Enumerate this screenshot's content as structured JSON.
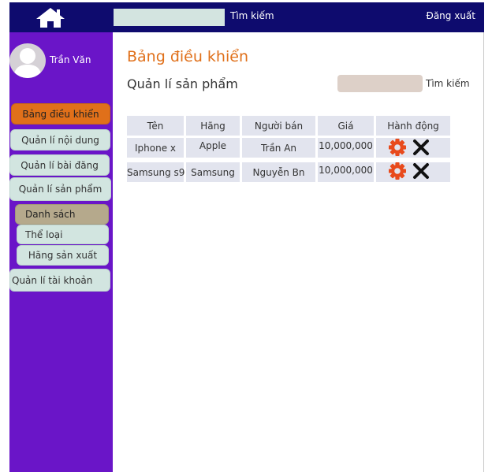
{
  "header": {
    "search_label": "Tìm kiếm",
    "search_value": "",
    "logout_label": "Đăng xuất"
  },
  "sidebar": {
    "username": "Trần Văn",
    "items": [
      {
        "label": "Bảng điều khiển"
      },
      {
        "label": "Quản lí nội dung"
      },
      {
        "label": "Quản lí bài đăng"
      },
      {
        "label": "Quản lí sản phẩm"
      },
      {
        "label": "Danh sách"
      },
      {
        "label": "Thể loại"
      },
      {
        "label": "Hãng sản xuất"
      },
      {
        "label": "Quản lí tài khoản"
      }
    ]
  },
  "main": {
    "title": "Bảng điều khiển",
    "section_title": "Quản lí sản phẩm",
    "search_label": "Tìm kiếm",
    "search_value": "",
    "table": {
      "headers": [
        "Tên",
        "Hãng",
        "Người bán",
        "Giá",
        "Hành động"
      ],
      "rows": [
        [
          "Iphone x",
          "Apple",
          "Trần An",
          "10,000,000"
        ],
        [
          "Samsung s9",
          "Samsung",
          "Nguyễn Bn",
          "10,000,000"
        ]
      ]
    }
  },
  "colors": {
    "topbar": "#0e0b6e",
    "sidebar": "#6a15c8",
    "accent": "#e0701a",
    "edit_icon": "#e84a1c",
    "delete_icon": "#111111"
  },
  "icons": {
    "home": "home-icon",
    "avatar": "user-avatar",
    "edit": "gear-icon",
    "delete": "close-icon"
  }
}
